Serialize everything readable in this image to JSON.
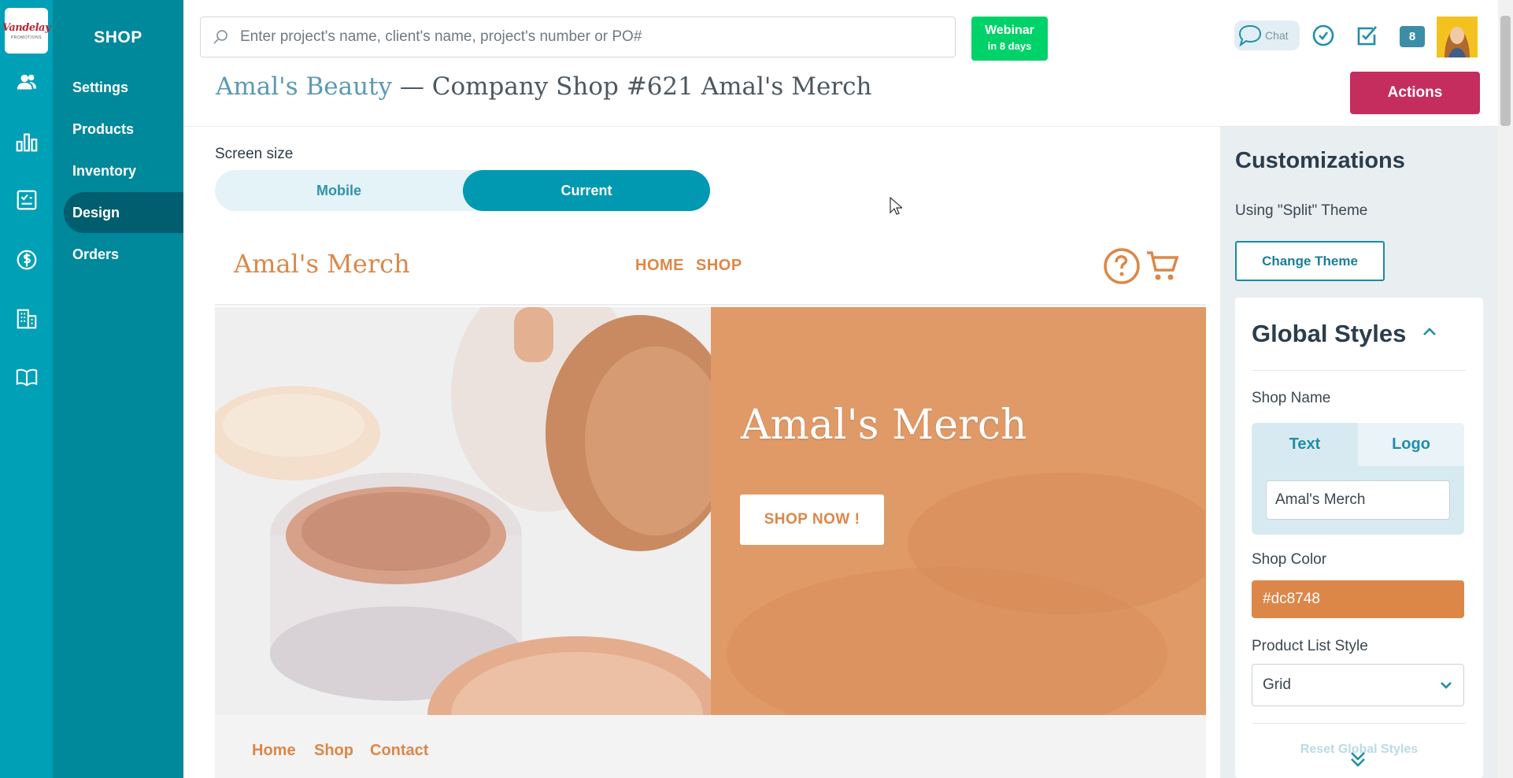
{
  "app": {
    "logo_line1": "Vandelay",
    "logo_line2": "PROMOTIONS"
  },
  "rail": {
    "items": [
      {
        "icon": "users-icon"
      },
      {
        "icon": "bar-chart-icon"
      },
      {
        "icon": "checklist-icon"
      },
      {
        "icon": "dollar-icon"
      },
      {
        "icon": "building-icon"
      },
      {
        "icon": "book-icon"
      }
    ]
  },
  "subnav": {
    "title": "SHOP",
    "items": [
      {
        "label": "Settings",
        "active": false
      },
      {
        "label": "Products",
        "active": false
      },
      {
        "label": "Inventory",
        "active": false
      },
      {
        "label": "Design",
        "active": true
      },
      {
        "label": "Orders",
        "active": false
      }
    ]
  },
  "header": {
    "search_placeholder": "Enter project's name, client's name, project's number or PO#",
    "webinar_title": "Webinar",
    "webinar_sub": "in 8 days",
    "chat_label": "Chat",
    "badge_count": "8",
    "client_name": "Amal's Beauty",
    "separator": " — ",
    "project_title": "Company Shop #621 Amal's Merch",
    "actions_label": "Actions"
  },
  "preview": {
    "screen_size_label": "Screen size",
    "toggle_mobile": "Mobile",
    "toggle_current": "Current",
    "brand": "Amal's Merch",
    "nav_home": "HOME",
    "nav_shop": "SHOP",
    "hero_title": "Amal's Merch",
    "hero_cta": "SHOP NOW !",
    "footer_home": "Home",
    "footer_shop": "Shop",
    "footer_contact": "Contact"
  },
  "customizations": {
    "title": "Customizations",
    "theme_text": "Using \"Split\" Theme",
    "change_theme": "Change Theme",
    "global_styles_title": "Global Styles",
    "shop_name_label": "Shop Name",
    "seg_text": "Text",
    "seg_logo": "Logo",
    "shop_name_value": "Amal's Merch",
    "shop_color_label": "Shop Color",
    "shop_color_value": "#dc8748",
    "product_list_label": "Product List Style",
    "product_list_value": "Grid",
    "reset_label": "Reset Global Styles"
  },
  "colors": {
    "rail": "#00a0b6",
    "subnav": "#00889b",
    "subnav_active": "#005e6e",
    "accent": "#0099b1",
    "actions": "#c52d5e",
    "webinar": "#00d26a",
    "shop_color": "#dc8748"
  }
}
